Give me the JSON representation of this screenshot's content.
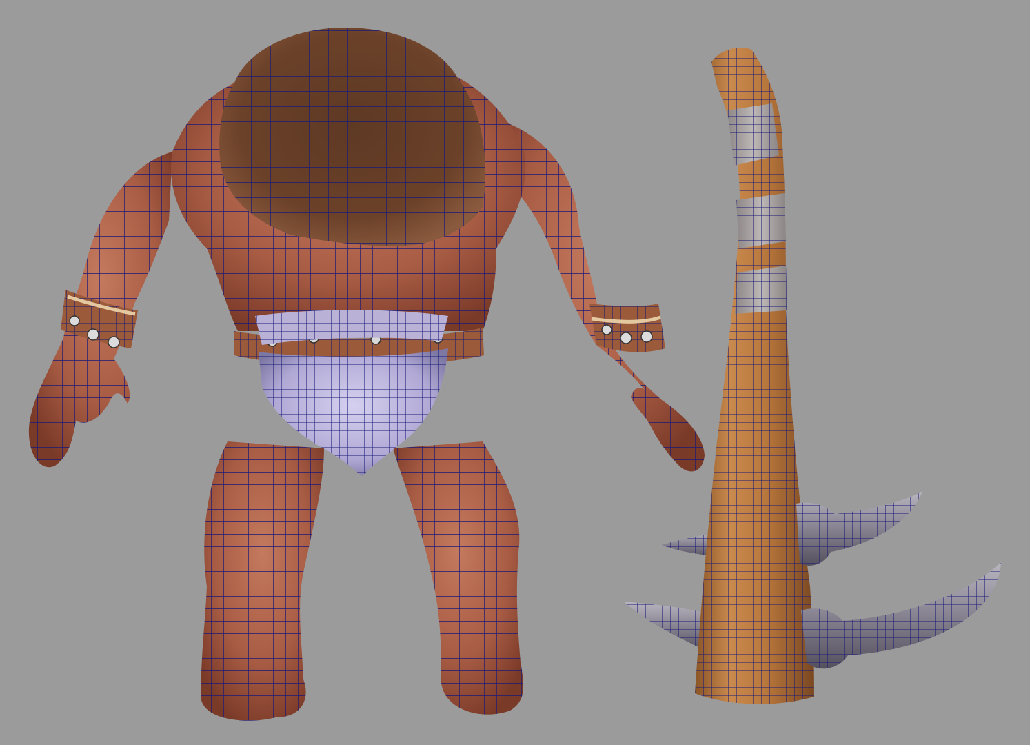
{
  "viewport": {
    "background_color": "#9b9b9b",
    "shading_mode": "wireframe-on-textured",
    "wire_color": "#1a1a78"
  },
  "scene": {
    "objects": [
      {
        "name": "ogre-character",
        "view": "back",
        "materials": [
          "skin",
          "hair",
          "loincloth",
          "leather-bracers",
          "metal-studs"
        ]
      },
      {
        "name": "spiked-club",
        "materials": [
          "wood",
          "cloth-wrap",
          "horn-spikes"
        ]
      }
    ],
    "colors": {
      "skin": "#b0664f",
      "skin_dark": "#7e3f2d",
      "hair": "#5a3622",
      "cloth": "#b3abd3",
      "leather": "#9b5b3a",
      "wood": "#c08146",
      "wrap": "#a39b9b",
      "horn": "#8a8590",
      "stud": "#d8d8d8"
    }
  }
}
